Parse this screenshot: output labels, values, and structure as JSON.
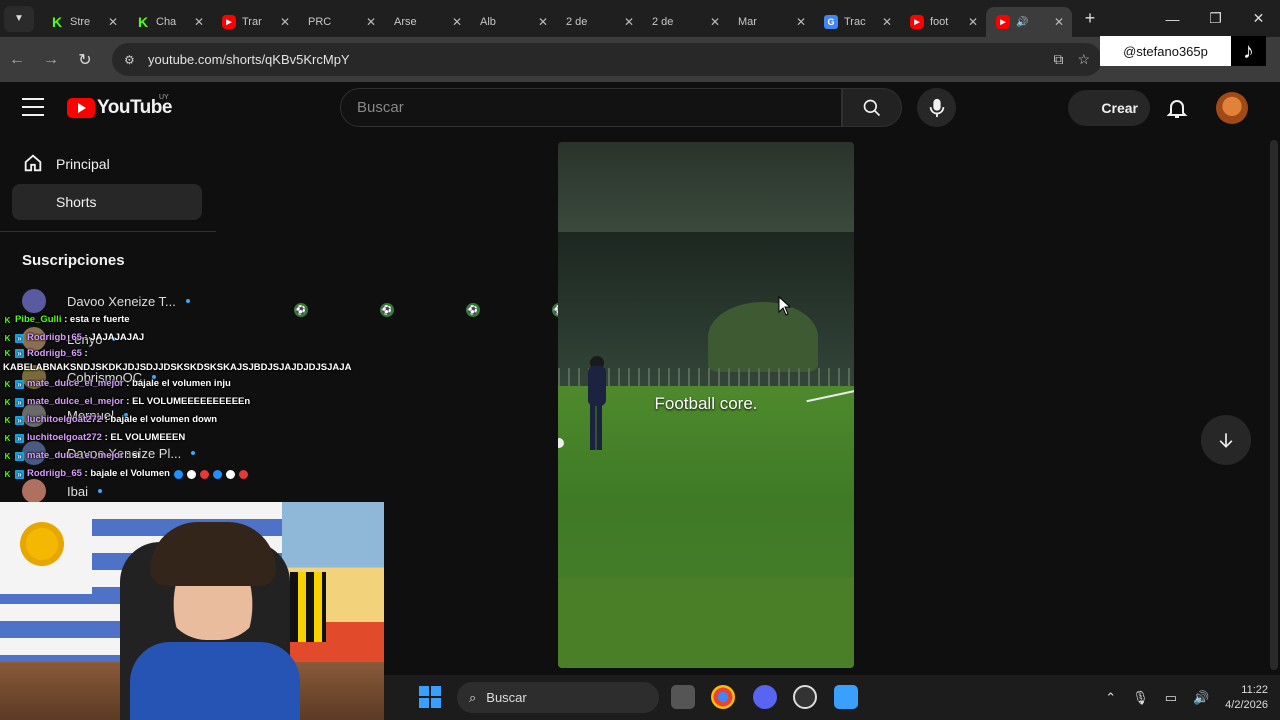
{
  "browser": {
    "tabs": [
      {
        "icon": "kick-icon",
        "title": "Stre"
      },
      {
        "icon": "kick-icon",
        "title": "Cha"
      },
      {
        "icon": "youtube-icon",
        "title": "Trar"
      },
      {
        "icon": "ball-icon",
        "title": "PRC"
      },
      {
        "icon": "ball-icon",
        "title": "Arse"
      },
      {
        "icon": "ball-icon",
        "title": "Alb"
      },
      {
        "icon": "ball-icon",
        "title": "2 de"
      },
      {
        "icon": "ball-icon",
        "title": "2 de"
      },
      {
        "icon": "ball-icon",
        "title": "Mar"
      },
      {
        "icon": "translate-icon",
        "title": "Trac"
      },
      {
        "icon": "youtube-icon",
        "title": "foot"
      },
      {
        "icon": "youtube-icon",
        "title": "",
        "active": true,
        "audio": true
      }
    ],
    "url": "youtube.com/shorts/qKBv5KrcMpY"
  },
  "overlay": {
    "tiktok_handle": "@stefano365p"
  },
  "youtube": {
    "logo_text": "YouTube",
    "logo_country": "UY",
    "search_placeholder": "Buscar",
    "create_label": "Crear",
    "sidebar": {
      "items": [
        {
          "label": "Principal",
          "icon": "home-icon"
        },
        {
          "label": "Shorts",
          "icon": "shorts-icon",
          "active": true
        }
      ],
      "subscriptions_title": "Suscripciones",
      "subscriptions": [
        {
          "name": "Davoo Xeneize T...",
          "color": "#5a5aa0"
        },
        {
          "name": "Lenyo",
          "color": "#8a7050"
        },
        {
          "name": "CobrismoOC",
          "color": "#7a6a3a"
        },
        {
          "name": "Mernuel",
          "color": "#6a6a6a"
        },
        {
          "name": "Davoo Xeneize Pl...",
          "color": "#4a5a80"
        },
        {
          "name": "Ibai",
          "color": "#b07060"
        }
      ]
    },
    "video": {
      "caption": "Football core."
    }
  },
  "chat": {
    "messages": [
      {
        "user": "Pibe_Gulli",
        "text": "esta re fuerte",
        "badges": [
          "k"
        ]
      },
      {
        "user": "Rodriigb_65",
        "text": "JAJAJAJAJ",
        "badges": [
          "k",
          "s"
        ]
      },
      {
        "user": "Rodriigb_65",
        "text": "KABELABNAKSNDJSKDKJDJSDJJDSKSKDSKSKAJSJBDJSJAJDJDJSJAJA",
        "badges": [
          "k",
          "s"
        ],
        "wrap": true
      },
      {
        "user": "mate_dulce_el_mejor",
        "text": "bajale el volumen inju",
        "badges": [
          "k",
          "s"
        ]
      },
      {
        "user": "mate_dulce_el_mejor",
        "text": "EL VOLUMEEEEEEEEEEn",
        "badges": [
          "k",
          "s"
        ]
      },
      {
        "user": "luchitoelgoat272",
        "text": "bajale el volumen down",
        "badges": [
          "k",
          "s"
        ]
      },
      {
        "user": "luchitoelgoat272",
        "text": "EL VOLUMEEEN",
        "badges": [
          "k",
          "s"
        ]
      },
      {
        "user": "mate_dulce_el_mejor",
        "text": "si",
        "badges": [
          "k",
          "s"
        ]
      },
      {
        "user": "Rodriigb_65",
        "text": "bajale el Volumen",
        "badges": [
          "k",
          "s"
        ],
        "emojis": [
          "#1e90ff",
          "#ffffff",
          "#e53935",
          "#1e90ff",
          "#ffffff",
          "#e53935"
        ]
      }
    ]
  },
  "taskbar": {
    "search_placeholder": "Buscar",
    "time": "11:22",
    "date": "4/2/2026"
  }
}
